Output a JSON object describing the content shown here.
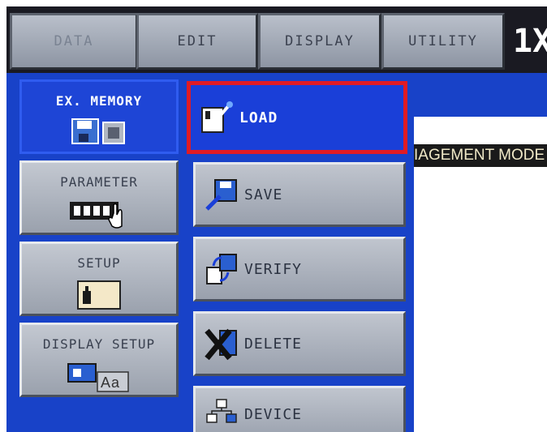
{
  "tabs": [
    {
      "label": "DATA"
    },
    {
      "label": "EDIT"
    },
    {
      "label": "DISPLAY"
    },
    {
      "label": "UTILITY"
    }
  ],
  "zoom_indicator": "1X",
  "left_menu": [
    {
      "label": "EX. MEMORY",
      "icon": "floppy-memory-icon",
      "active": true
    },
    {
      "label": "PARAMETER",
      "icon": "keypad-hand-icon"
    },
    {
      "label": "SETUP",
      "icon": "setup-panel-icon"
    },
    {
      "label": "DISPLAY SETUP",
      "icon": "display-font-icon",
      "extra": "Aa"
    }
  ],
  "function_menu": [
    {
      "label": "LOAD",
      "icon": "load-icon",
      "selected": true
    },
    {
      "label": "SAVE",
      "icon": "save-icon"
    },
    {
      "label": "VERIFY",
      "icon": "verify-icon"
    },
    {
      "label": "DELETE",
      "icon": "delete-icon"
    },
    {
      "label": "DEVICE",
      "icon": "device-icon"
    }
  ],
  "right_panel": {
    "title_fragment": "IAGEMENT MODE"
  },
  "colors": {
    "selection_border": "#e01b24",
    "panel_blue": "#1842c8",
    "button_gray": "#b3b9c4"
  }
}
